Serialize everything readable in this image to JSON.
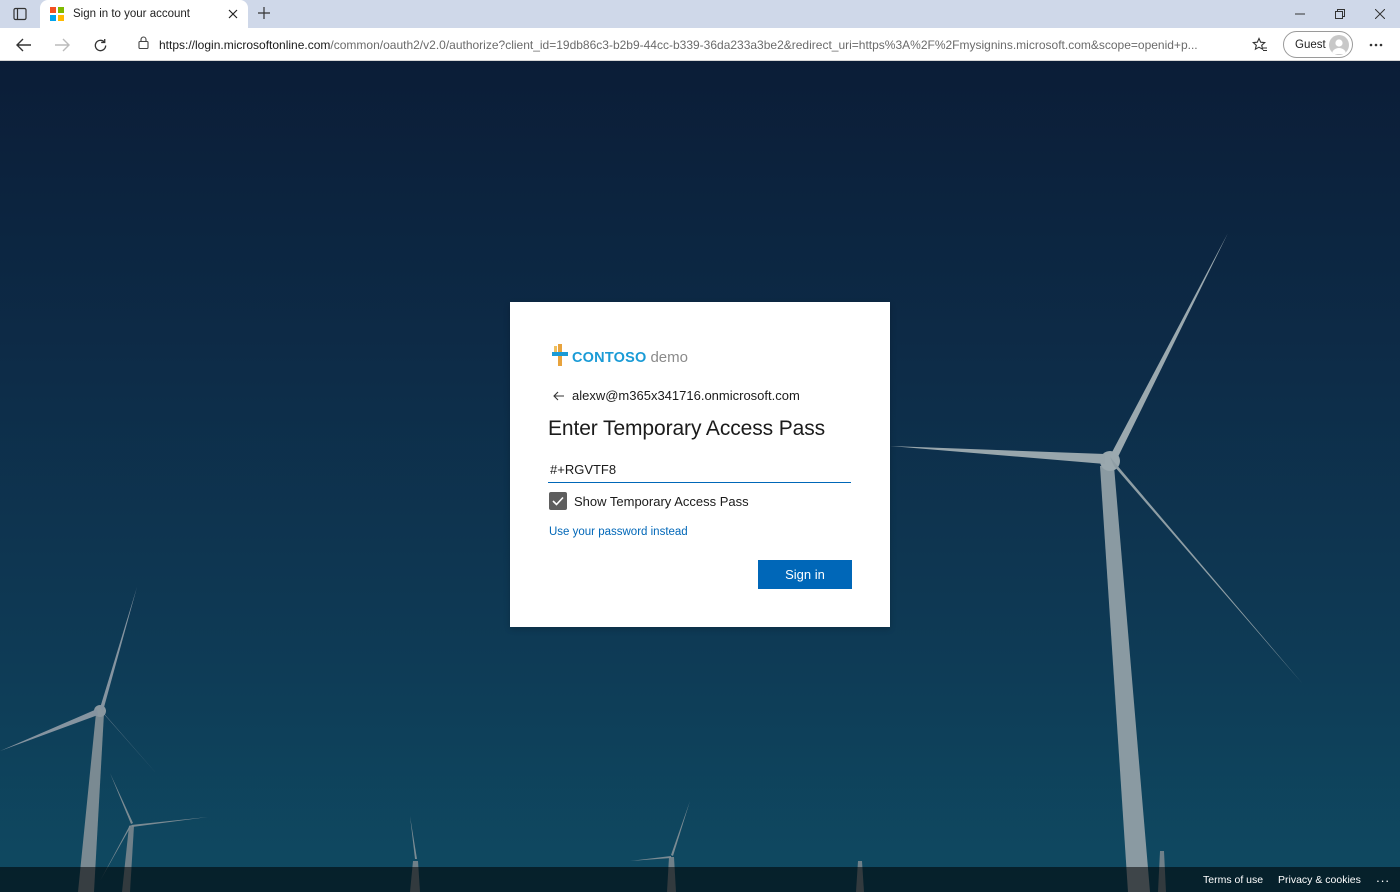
{
  "browser": {
    "tab": {
      "title": "Sign in to your account",
      "favicon": "microsoft-logo-icon"
    },
    "toolbar": {
      "url_host": "https://login.microsoftonline.com",
      "url_path": "/common/oauth2/v2.0/authorize?client_id=19db86c3-b2b9-44cc-b339-36da233a3be2&redirect_uri=https%3A%2F%2Fmysignins.microsoft.com&scope=openid+p...",
      "profile_label": "Guest"
    }
  },
  "signin": {
    "brand_primary": "CONTOSO",
    "brand_secondary": "demo",
    "identity": "alexw@m365x341716.onmicrosoft.com",
    "heading": "Enter Temporary Access Pass",
    "pass_value": "#+RGVTF8",
    "show_pass_label": "Show Temporary Access Pass",
    "show_pass_checked": true,
    "alt_link": "Use your password instead",
    "submit_label": "Sign in"
  },
  "footer": {
    "terms": "Terms of use",
    "privacy": "Privacy & cookies",
    "more": "..."
  },
  "colors": {
    "accent": "#0067b8",
    "brand": "#1a9bd6",
    "background": "#0d2b47"
  }
}
